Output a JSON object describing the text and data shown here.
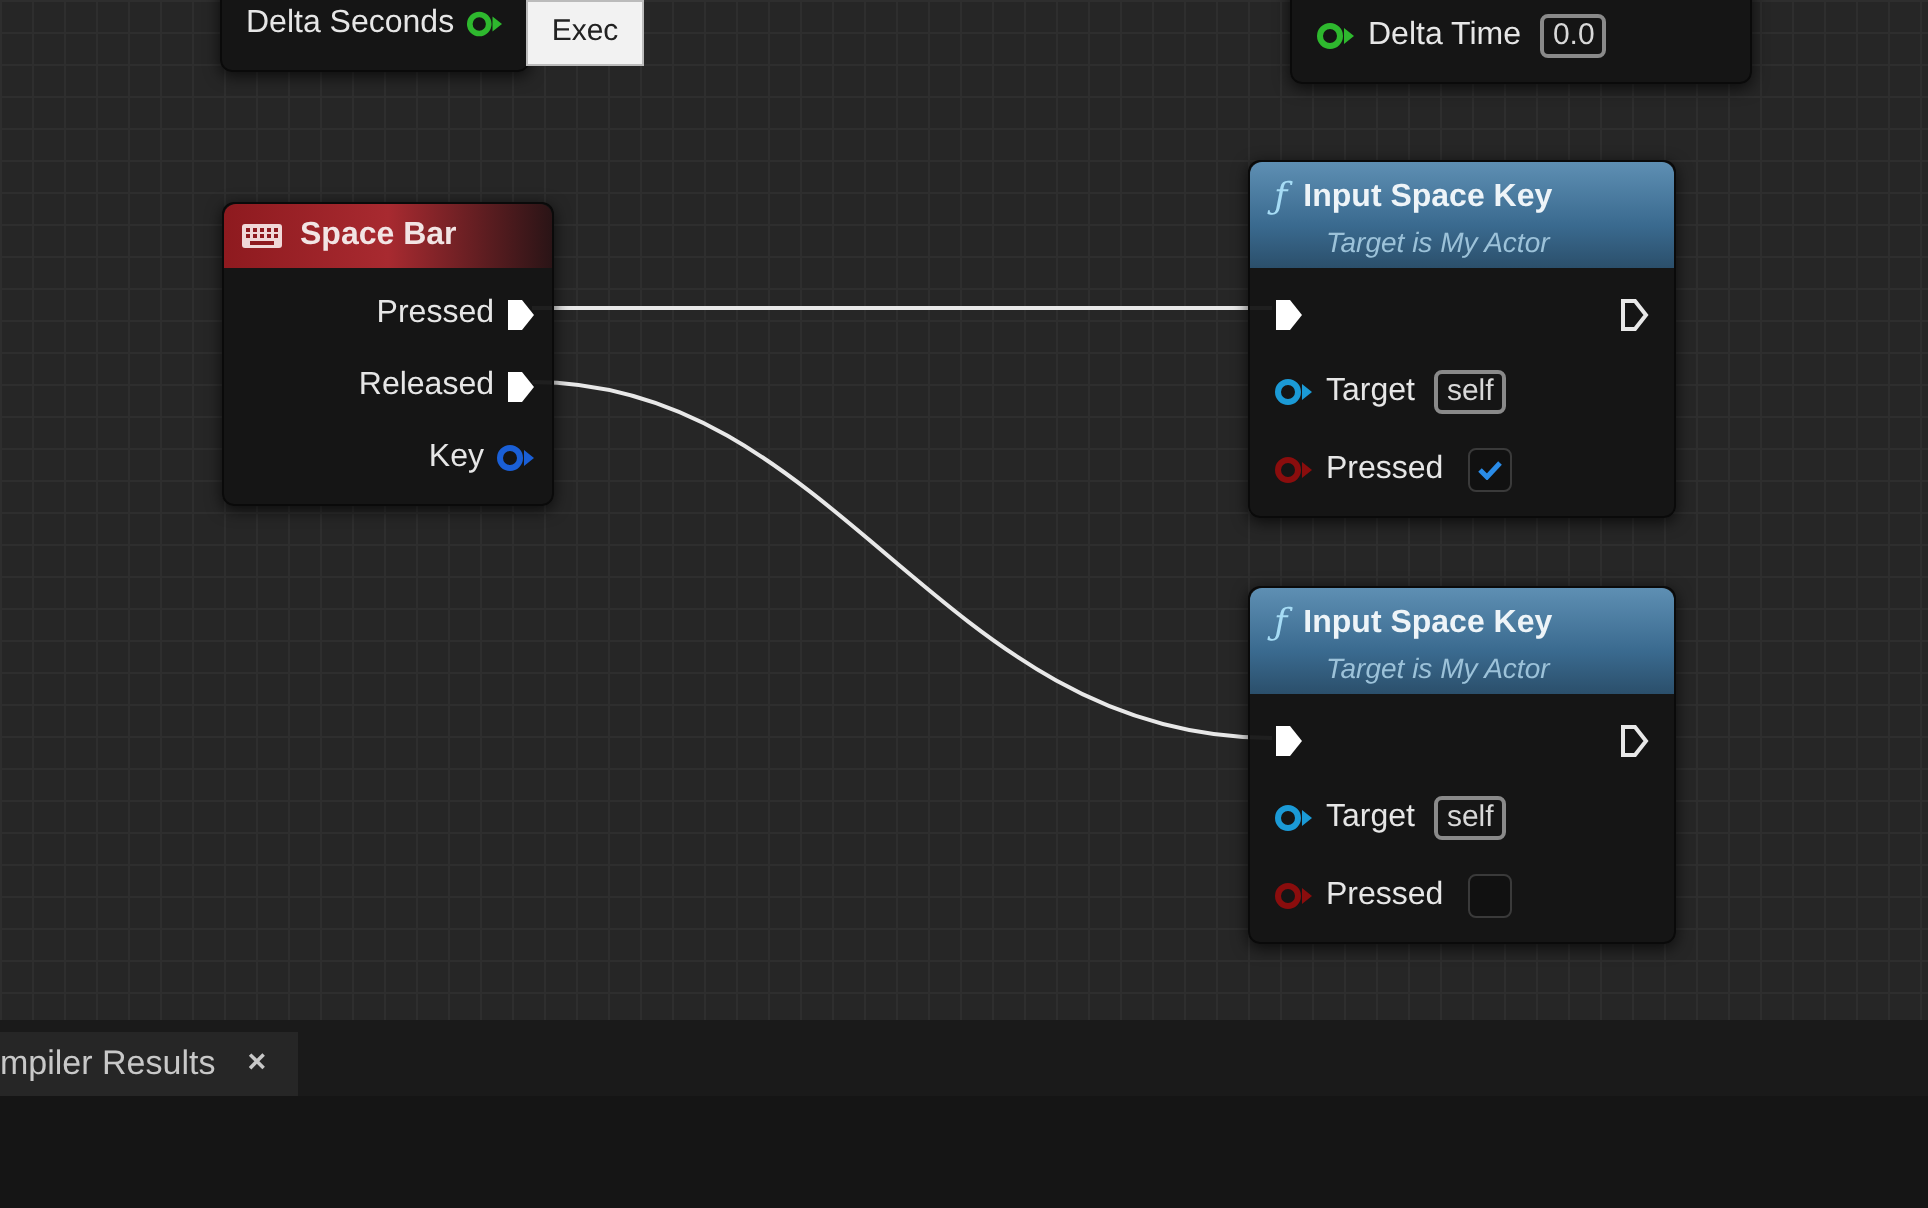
{
  "tooltip": {
    "text": "Exec"
  },
  "nodes": [
    {
      "kind": "output_stub",
      "pins": [
        {
          "kind": "float",
          "label": "Delta Seconds",
          "color": "#2eb82e"
        }
      ]
    },
    {
      "kind": "input_stub",
      "pins": [
        {
          "kind": "float",
          "label": "Delta Time",
          "color": "#2eb82e",
          "value": "0.0"
        }
      ]
    },
    {
      "kind": "event",
      "title": "Space Bar",
      "pins": [
        {
          "kind": "exec",
          "label": "Pressed"
        },
        {
          "kind": "exec",
          "label": "Released"
        },
        {
          "kind": "object",
          "label": "Key",
          "color": "#1a5fd6"
        }
      ]
    },
    {
      "kind": "function",
      "icon": "ƒ",
      "title": "Input Space Key",
      "subtitle": "Target is My Actor",
      "pins": [
        {
          "kind": "exec_pair"
        },
        {
          "kind": "object",
          "label": "Target",
          "color": "#1b9ad6",
          "value": "self"
        },
        {
          "kind": "bool",
          "label": "Pressed",
          "color": "#8a0d0d",
          "checked": true
        }
      ]
    },
    {
      "kind": "function",
      "icon": "ƒ",
      "title": "Input Space Key",
      "subtitle": "Target is My Actor",
      "pins": [
        {
          "kind": "exec_pair"
        },
        {
          "kind": "object",
          "label": "Target",
          "color": "#1b9ad6",
          "value": "self"
        },
        {
          "kind": "bool",
          "label": "Pressed",
          "color": "#8a0d0d",
          "checked": false
        }
      ]
    }
  ],
  "bottom_panel": {
    "tabs": [
      {
        "label": "mpiler Results",
        "close": "×",
        "selected": true
      }
    ]
  }
}
